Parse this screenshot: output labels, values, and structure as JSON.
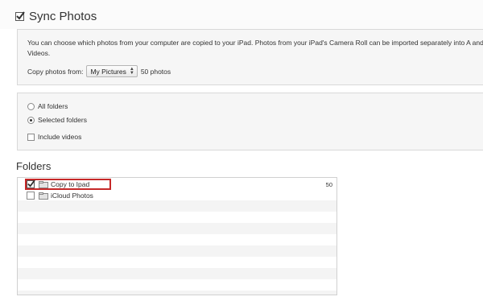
{
  "sync": {
    "title": "Sync Photos",
    "checked": true
  },
  "description": "You can choose which photos from your computer are copied to your iPad. Photos from your iPad's Camera Roll can be imported separately into Aperture, iPhoto, or other applications. Photos and Videos.",
  "description_visible": "You can choose which photos from your computer are copied to your iPad. Photos from your iPad's Camera Roll can be imported separately into A and Videos.",
  "copy_from": {
    "label": "Copy photos from:",
    "selected": "My Pictures",
    "count": "50 photos"
  },
  "options": {
    "all_folders": "All folders",
    "selected_folders": "Selected folders",
    "include_videos": "Include videos",
    "selected": "selected_folders",
    "include_videos_checked": false
  },
  "folders": {
    "heading": "Folders",
    "items": [
      {
        "name": "Copy to Ipad",
        "checked": true,
        "count": "50"
      },
      {
        "name": "iCloud Photos",
        "checked": false,
        "count": ""
      }
    ]
  },
  "colors": {
    "highlight": "#c62828",
    "panel_bg": "#f6f6f6",
    "stripe": "#f4f4f4"
  }
}
